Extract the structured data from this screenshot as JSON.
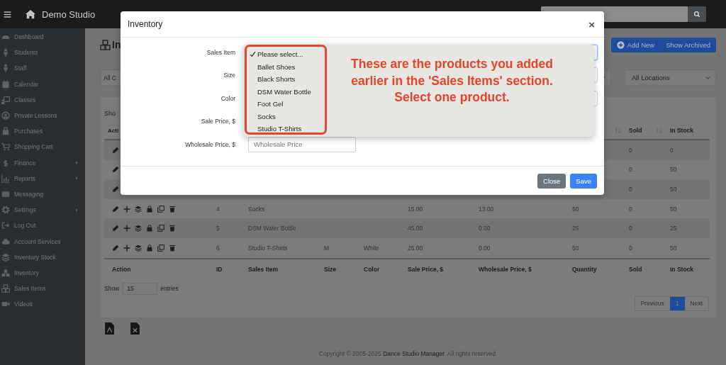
{
  "topbar": {
    "brand": "Demo Studio"
  },
  "sidebar": {
    "items": [
      {
        "label": "Dashboard",
        "submenu": false
      },
      {
        "label": "Students",
        "submenu": false
      },
      {
        "label": "Staff",
        "submenu": false
      },
      {
        "label": "Calendar",
        "submenu": false
      },
      {
        "label": "Classes",
        "submenu": false
      },
      {
        "label": "Private Lessons",
        "submenu": false
      },
      {
        "label": "Purchases",
        "submenu": false
      },
      {
        "label": "Shopping Cart",
        "submenu": false
      },
      {
        "label": "Finance",
        "submenu": true
      },
      {
        "label": "Reports",
        "submenu": true
      },
      {
        "label": "Messaging",
        "submenu": false
      },
      {
        "label": "Settings",
        "submenu": true
      },
      {
        "label": "Log Out",
        "submenu": false
      },
      {
        "label": "Account Services",
        "submenu": false
      },
      {
        "label": "Inventory Stock",
        "submenu": false
      },
      {
        "label": "Inventory",
        "submenu": false
      },
      {
        "label": "Sales Items",
        "submenu": false
      },
      {
        "label": "Videos",
        "submenu": false
      }
    ]
  },
  "page": {
    "heading": "In",
    "buttons": [
      {
        "label": "Add New",
        "kind": "add"
      },
      {
        "label": "Show Archived",
        "kind": "plain"
      }
    ],
    "filters": [
      {
        "value": "All C",
        "kind": "cut"
      },
      {
        "kind": "empty"
      },
      {
        "value": "All Locations",
        "kind": "full"
      }
    ]
  },
  "table": {
    "show_label": "Sho",
    "header_top": {
      "action": {
        "label": "Acti"
      },
      "quantity": {
        "sortable": true
      },
      "sold": {
        "label": "Sold",
        "sortable": true
      },
      "in_stock": {
        "label": "In Stock"
      }
    },
    "rows": [
      {
        "kind": "covered",
        "sold": "0",
        "in_stock": "0"
      },
      {
        "kind": "covered",
        "sold": "0",
        "in_stock": "50"
      },
      {
        "kind": "covered",
        "sold": "0",
        "in_stock": "50"
      },
      {
        "kind": "full",
        "id": "4",
        "sales_item": "Socks",
        "sale_price": "15.00",
        "wholesale_price": "13.00",
        "quantity": "50",
        "sold": "0",
        "in_stock": "50"
      },
      {
        "kind": "full",
        "id": "5",
        "sales_item": "DSM Water Bottle",
        "sale_price": "45.00",
        "wholesale_price": "0.00",
        "quantity": "25",
        "sold": "0",
        "in_stock": "25"
      },
      {
        "kind": "full",
        "id": "6",
        "sales_item": "Studio T-Shirts",
        "size": "M",
        "item_color": "White",
        "sale_price": "25.00",
        "wholesale_price": "0.00",
        "quantity": "50",
        "sold": "0",
        "in_stock": "50"
      }
    ],
    "columns": [
      "Action",
      "ID",
      "Sales Item",
      "Size",
      "Color",
      "Sale Price, $",
      "Wholesale Price, $",
      "Quantity",
      "Sold",
      "In Stock"
    ],
    "length": {
      "before": "Show",
      "value": "15",
      "after": "entries"
    },
    "pagination": [
      {
        "label": "Previous",
        "selected": false
      },
      {
        "label": "1",
        "selected": true
      },
      {
        "label": "Next",
        "selected": false
      }
    ]
  },
  "footer": {
    "before": "Copyright © 2005-2025 ",
    "link": "Dance Studio Manager",
    "after": ". All rights reserved."
  },
  "modal": {
    "title": "Inventory",
    "close": "×",
    "fields": [
      {
        "label": "Sales Item",
        "kind": "select",
        "focused": true
      },
      {
        "label": "Size",
        "kind": "select",
        "focused": false
      },
      {
        "label": "Color",
        "kind": "select",
        "focused": false
      },
      {
        "label": "Sale Price, $",
        "kind": "covered"
      },
      {
        "label": "Wholesale Price, $",
        "kind": "input",
        "placeholder": "Wholesale Price"
      }
    ],
    "dropdown": {
      "options": [
        {
          "label": "Please select...",
          "selected": true
        },
        {
          "label": "Ballet Shoes",
          "selected": false
        },
        {
          "label": "Black Shorts",
          "selected": false
        },
        {
          "label": "DSM Water Bottle",
          "selected": false
        },
        {
          "label": "Foot Gel",
          "selected": false
        },
        {
          "label": "Socks",
          "selected": false
        },
        {
          "label": "Studio T-Shirts",
          "selected": false
        }
      ],
      "annotation": "These are the products you added earlier in the 'Sales Items' section. Select one product."
    },
    "buttons": [
      {
        "label": "Close",
        "kind": "secondary"
      },
      {
        "label": "Save",
        "kind": "primary"
      }
    ]
  }
}
